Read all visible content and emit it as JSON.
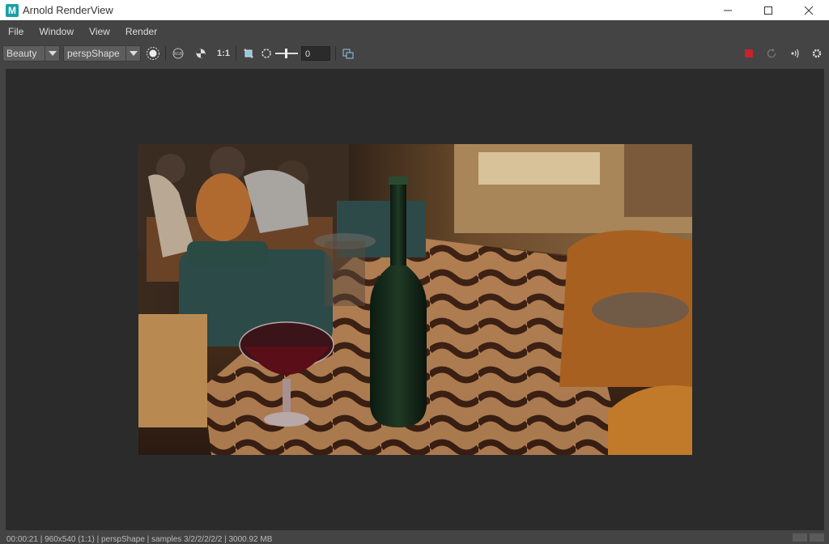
{
  "window": {
    "title": "Arnold RenderView",
    "logo_letter": "M",
    "minimize_glyph": "—",
    "maximize_glyph": "☐",
    "close_glyph": "✕"
  },
  "menu": {
    "items": [
      "File",
      "Window",
      "View",
      "Render"
    ]
  },
  "toolbar": {
    "aov": "Beauty",
    "camera": "perspShape",
    "ratio_label": "1:1",
    "exposure_value": "0"
  },
  "status": {
    "text": "00:00:21 | 960x540 (1:1) | perspShape | samples 3/2/2/2/2/2 | 3000.92 MB"
  },
  "colors": {
    "accent_red": "#c8232c",
    "ui_bg": "#444444",
    "viewport_bg": "#2b2b2b",
    "logo": "#1aa0a8"
  },
  "icons": {
    "display_icon": "circle-display-icon",
    "rgb_icon": "rgb-channel-icon",
    "checker_icon": "checker-icon",
    "crop_icon": "crop-region-icon",
    "exposure_icon": "exposure-icon",
    "snapshot_icon": "snapshot-icon",
    "stop_icon": "stop-icon",
    "refresh_icon": "refresh-icon",
    "ipr_icon": "ipr-icon",
    "settings_icon": "gear-icon"
  }
}
